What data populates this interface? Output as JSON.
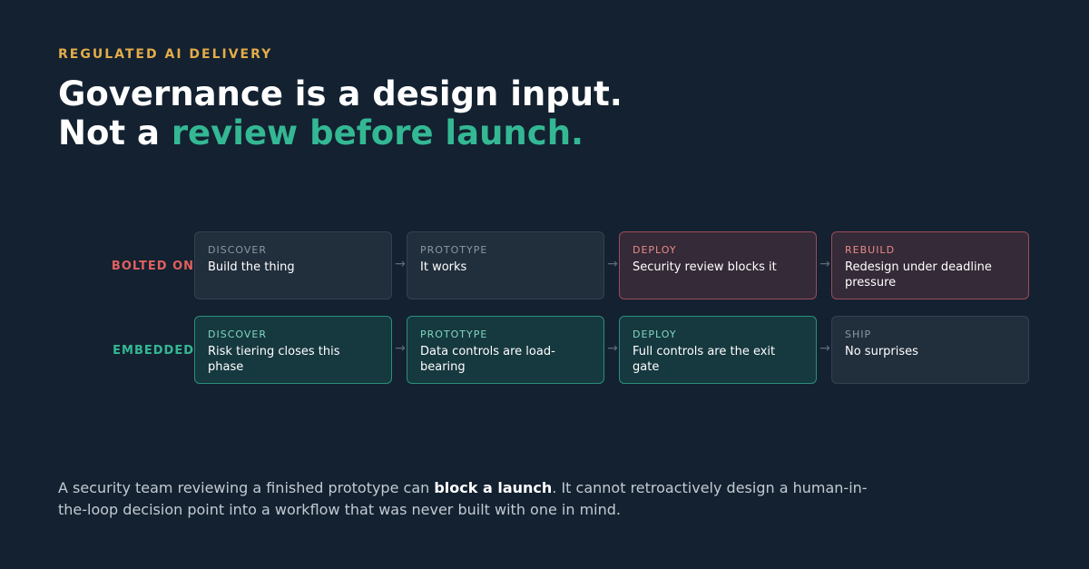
{
  "eyebrow": "REGULATED AI DELIVERY",
  "headline": {
    "line1": "Governance is a design input.",
    "line2_prefix": "Not a ",
    "line2_accent": "review before launch."
  },
  "rows": {
    "bolted": {
      "label": "BOLTED ON",
      "stages": [
        {
          "stage": "DISCOVER",
          "text": "Build the thing"
        },
        {
          "stage": "PROTOTYPE",
          "text": "It works"
        },
        {
          "stage": "DEPLOY",
          "text": "Security review blocks it"
        },
        {
          "stage": "REBUILD",
          "text": "Redesign under deadline pressure"
        }
      ]
    },
    "embedded": {
      "label": "EMBEDDED",
      "stages": [
        {
          "stage": "DISCOVER",
          "text": "Risk tiering closes this phase"
        },
        {
          "stage": "PROTOTYPE",
          "text": "Data controls are load-bearing"
        },
        {
          "stage": "DEPLOY",
          "text": "Full controls are the exit gate"
        },
        {
          "stage": "SHIP",
          "text": "No surprises"
        }
      ]
    }
  },
  "arrow_glyph": "→",
  "footnote": {
    "before": "A security team reviewing a finished prototype can ",
    "bold": "block a launch",
    "after": ". It cannot retroactively design a human-in-the-loop decision point into a workflow that was never built with one in mind."
  },
  "colors": {
    "background": "#132130",
    "eyebrow": "#e3ac4a",
    "accent_green": "#34b894",
    "accent_red": "#e0605f"
  }
}
